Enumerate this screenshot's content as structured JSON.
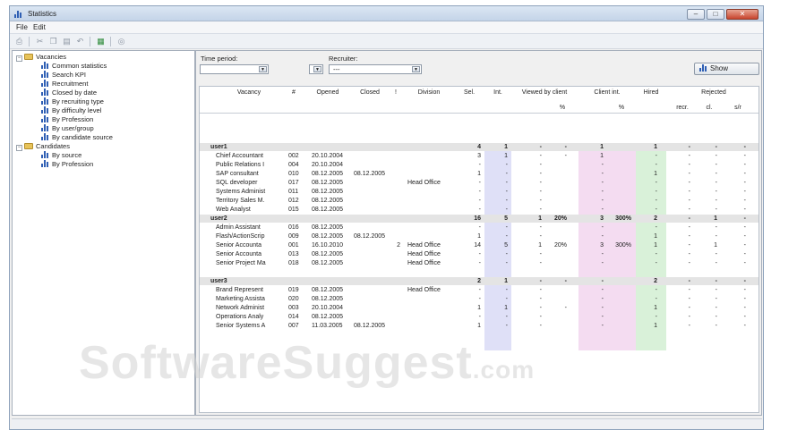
{
  "window": {
    "title": "Statistics"
  },
  "menu": {
    "file": "File",
    "edit": "Edit"
  },
  "tree": {
    "vacancies": "Vacancies",
    "vacancy_items": [
      "Common statistics",
      "Search KPI",
      "Recruitment",
      "Closed by date",
      "By recruiting type",
      "By difficulty level",
      "By Profession",
      "By user/group",
      "By candidate source"
    ],
    "candidates": "Candidates",
    "candidate_items": [
      "By source",
      "By Profession"
    ]
  },
  "filters": {
    "time_period_label": "Time period:",
    "recruiter_label": "Recruiter:",
    "recruiter_value": "---",
    "show_button": "Show"
  },
  "table": {
    "headers": {
      "vacancy": "Vacancy",
      "num": "#",
      "opened": "Opened",
      "closed": "Closed",
      "excl": "!",
      "division": "Division",
      "sel": "Sel.",
      "int": "Int.",
      "viewed": "Viewed by client",
      "client_int": "Client int.",
      "hired": "Hired",
      "rejected": "Rejected",
      "pct1": "%",
      "pct2": "%",
      "recr": "recr.",
      "cl": "cl.",
      "sr": "s/r"
    },
    "groups": [
      {
        "name": "user1",
        "totals": {
          "sel": "4",
          "int": "1",
          "viewed": "-",
          "viewed_pct": "-",
          "client": "1",
          "client_pct": "",
          "hired": "1",
          "recr": "-",
          "cl": "-",
          "sr": "-"
        },
        "rows": [
          {
            "vacancy": "Chief Accountant",
            "num": "002",
            "opened": "20.10.2004",
            "closed": "",
            "excl": "",
            "division": "",
            "sel": "3",
            "int": "1",
            "viewed": "-",
            "viewed_pct": "-",
            "client": "1",
            "client_pct": "",
            "hired": "-",
            "recr": "-",
            "cl": "-",
            "sr": "-"
          },
          {
            "vacancy": "Public Relations I",
            "num": "004",
            "opened": "20.10.2004",
            "closed": "",
            "excl": "",
            "division": "",
            "sel": "-",
            "int": "-",
            "viewed": "-",
            "viewed_pct": "",
            "client": "-",
            "client_pct": "",
            "hired": "-",
            "recr": "-",
            "cl": "-",
            "sr": "-"
          },
          {
            "vacancy": "SAP consultant",
            "num": "010",
            "opened": "08.12.2005",
            "closed": "08.12.2005",
            "excl": "",
            "division": "",
            "sel": "1",
            "int": "-",
            "viewed": "-",
            "viewed_pct": "",
            "client": "-",
            "client_pct": "",
            "hired": "1",
            "recr": "-",
            "cl": "-",
            "sr": "-"
          },
          {
            "vacancy": "SQL developer",
            "num": "017",
            "opened": "08.12.2005",
            "closed": "",
            "excl": "",
            "division": "Head Office",
            "sel": "-",
            "int": "-",
            "viewed": "-",
            "viewed_pct": "",
            "client": "-",
            "client_pct": "",
            "hired": "-",
            "recr": "-",
            "cl": "-",
            "sr": "-"
          },
          {
            "vacancy": "Systems Administ",
            "num": "011",
            "opened": "08.12.2005",
            "closed": "",
            "excl": "",
            "division": "",
            "sel": "-",
            "int": "-",
            "viewed": "-",
            "viewed_pct": "",
            "client": "-",
            "client_pct": "",
            "hired": "-",
            "recr": "-",
            "cl": "-",
            "sr": "-"
          },
          {
            "vacancy": "Territory Sales M.",
            "num": "012",
            "opened": "08.12.2005",
            "closed": "",
            "excl": "",
            "division": "",
            "sel": "-",
            "int": "-",
            "viewed": "-",
            "viewed_pct": "",
            "client": "-",
            "client_pct": "",
            "hired": "-",
            "recr": "-",
            "cl": "-",
            "sr": "-"
          },
          {
            "vacancy": "Web Analyst",
            "num": "015",
            "opened": "08.12.2005",
            "closed": "",
            "excl": "",
            "division": "",
            "sel": "-",
            "int": "-",
            "viewed": "-",
            "viewed_pct": "",
            "client": "-",
            "client_pct": "",
            "hired": "-",
            "recr": "-",
            "cl": "-",
            "sr": "-"
          }
        ]
      },
      {
        "name": "user2",
        "totals": {
          "sel": "16",
          "int": "5",
          "viewed": "1",
          "viewed_pct": "20%",
          "client": "3",
          "client_pct": "300%",
          "hired": "2",
          "recr": "-",
          "cl": "1",
          "sr": "-"
        },
        "rows": [
          {
            "vacancy": "Admin Assistant",
            "num": "016",
            "opened": "08.12.2005",
            "closed": "",
            "excl": "",
            "division": "",
            "sel": "-",
            "int": "-",
            "viewed": "-",
            "viewed_pct": "",
            "client": "-",
            "client_pct": "",
            "hired": "-",
            "recr": "-",
            "cl": "-",
            "sr": "-"
          },
          {
            "vacancy": "Flash/ActionScrip",
            "num": "009",
            "opened": "08.12.2005",
            "closed": "08.12.2005",
            "excl": "",
            "division": "",
            "sel": "1",
            "int": "-",
            "viewed": "-",
            "viewed_pct": "",
            "client": "-",
            "client_pct": "",
            "hired": "1",
            "recr": "-",
            "cl": "-",
            "sr": "-"
          },
          {
            "vacancy": "Senior Accounta",
            "num": "001",
            "opened": "16.10.2010",
            "closed": "",
            "excl": "2",
            "division": "Head Office",
            "sel": "14",
            "int": "5",
            "viewed": "1",
            "viewed_pct": "20%",
            "client": "3",
            "client_pct": "300%",
            "hired": "1",
            "recr": "-",
            "cl": "1",
            "sr": "-"
          },
          {
            "vacancy": "Senior Accounta",
            "num": "013",
            "opened": "08.12.2005",
            "closed": "",
            "excl": "",
            "division": "Head Office",
            "sel": "-",
            "int": "-",
            "viewed": "-",
            "viewed_pct": "",
            "client": "-",
            "client_pct": "",
            "hired": "-",
            "recr": "-",
            "cl": "-",
            "sr": "-"
          },
          {
            "vacancy": "Senior Project Ma",
            "num": "018",
            "opened": "08.12.2005",
            "closed": "",
            "excl": "",
            "division": "Head Office",
            "sel": "-",
            "int": "-",
            "viewed": "-",
            "viewed_pct": "",
            "client": "-",
            "client_pct": "",
            "hired": "-",
            "recr": "-",
            "cl": "-",
            "sr": "-"
          }
        ]
      },
      {
        "name": "user3",
        "totals": {
          "sel": "2",
          "int": "1",
          "viewed": "-",
          "viewed_pct": "-",
          "client": "-",
          "client_pct": "",
          "hired": "2",
          "recr": "-",
          "cl": "-",
          "sr": "-"
        },
        "rows": [
          {
            "vacancy": "Brand Represent",
            "num": "019",
            "opened": "08.12.2005",
            "closed": "",
            "excl": "",
            "division": "Head Office",
            "sel": "-",
            "int": "-",
            "viewed": "-",
            "viewed_pct": "",
            "client": "-",
            "client_pct": "",
            "hired": "-",
            "recr": "-",
            "cl": "-",
            "sr": "-"
          },
          {
            "vacancy": "Marketing Assista",
            "num": "020",
            "opened": "08.12.2005",
            "closed": "",
            "excl": "",
            "division": "",
            "sel": "-",
            "int": "-",
            "viewed": "-",
            "viewed_pct": "",
            "client": "-",
            "client_pct": "",
            "hired": "-",
            "recr": "-",
            "cl": "-",
            "sr": "-"
          },
          {
            "vacancy": "Network Administ",
            "num": "003",
            "opened": "20.10.2004",
            "closed": "",
            "excl": "",
            "division": "",
            "sel": "1",
            "int": "1",
            "viewed": "-",
            "viewed_pct": "-",
            "client": "-",
            "client_pct": "",
            "hired": "1",
            "recr": "-",
            "cl": "-",
            "sr": "-"
          },
          {
            "vacancy": "Operations Analy",
            "num": "014",
            "opened": "08.12.2005",
            "closed": "",
            "excl": "",
            "division": "",
            "sel": "-",
            "int": "-",
            "viewed": "-",
            "viewed_pct": "",
            "client": "-",
            "client_pct": "",
            "hired": "-",
            "recr": "-",
            "cl": "-",
            "sr": "-"
          },
          {
            "vacancy": "Senior Systems A",
            "num": "007",
            "opened": "11.03.2005",
            "closed": "08.12.2005",
            "excl": "",
            "division": "",
            "sel": "1",
            "int": "-",
            "viewed": "-",
            "viewed_pct": "",
            "client": "-",
            "client_pct": "",
            "hired": "1",
            "recr": "-",
            "cl": "-",
            "sr": "-"
          }
        ]
      }
    ]
  },
  "watermark": {
    "main": "SoftwareSuggest",
    "suffix": ".com"
  },
  "colors": {
    "int_col": "#dfe0f7",
    "client_col": "#f4dcf1",
    "hired_col": "#d9f1d9",
    "group_row": "#e4e4e4"
  }
}
